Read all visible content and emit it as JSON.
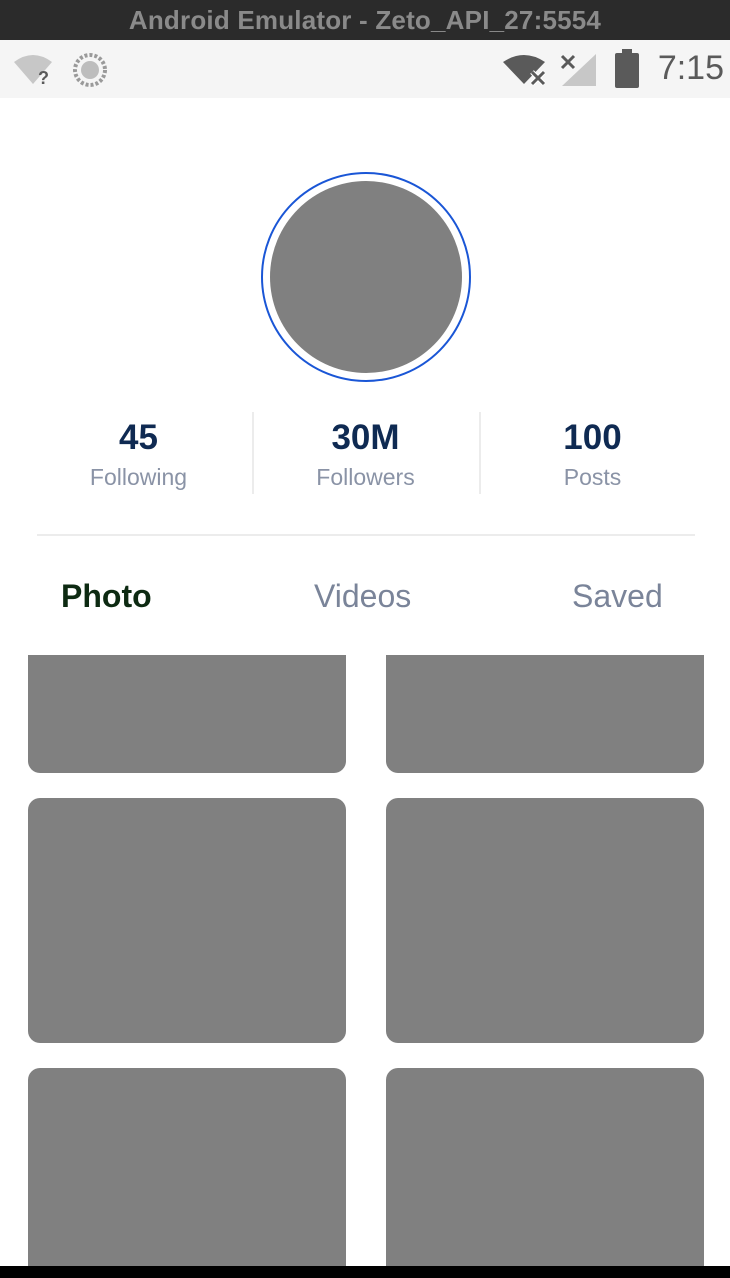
{
  "window": {
    "title": "Android Emulator - Zeto_API_27:5554"
  },
  "status_bar": {
    "time": "7:15",
    "icons": [
      "wifi-unknown-icon",
      "sync-icon",
      "wifi-off-icon",
      "no-signal-icon",
      "battery-icon"
    ]
  },
  "profile": {
    "avatar": "avatar-placeholder",
    "ring_color": "#1a56d6",
    "stats": [
      {
        "value": "45",
        "label": "Following"
      },
      {
        "value": "30M",
        "label": "Followers"
      },
      {
        "value": "100",
        "label": "Posts"
      }
    ]
  },
  "tabs": [
    {
      "label": "Photo",
      "active": true
    },
    {
      "label": "Videos",
      "active": false
    },
    {
      "label": "Saved",
      "active": false
    }
  ],
  "grid": {
    "tile_count": 6,
    "tile_color": "#808080"
  },
  "colors": {
    "stat_value": "#0f2a52",
    "stat_label": "#8a93a6",
    "tab_active": "#0d2a12",
    "tab_inactive": "#7a8499"
  }
}
